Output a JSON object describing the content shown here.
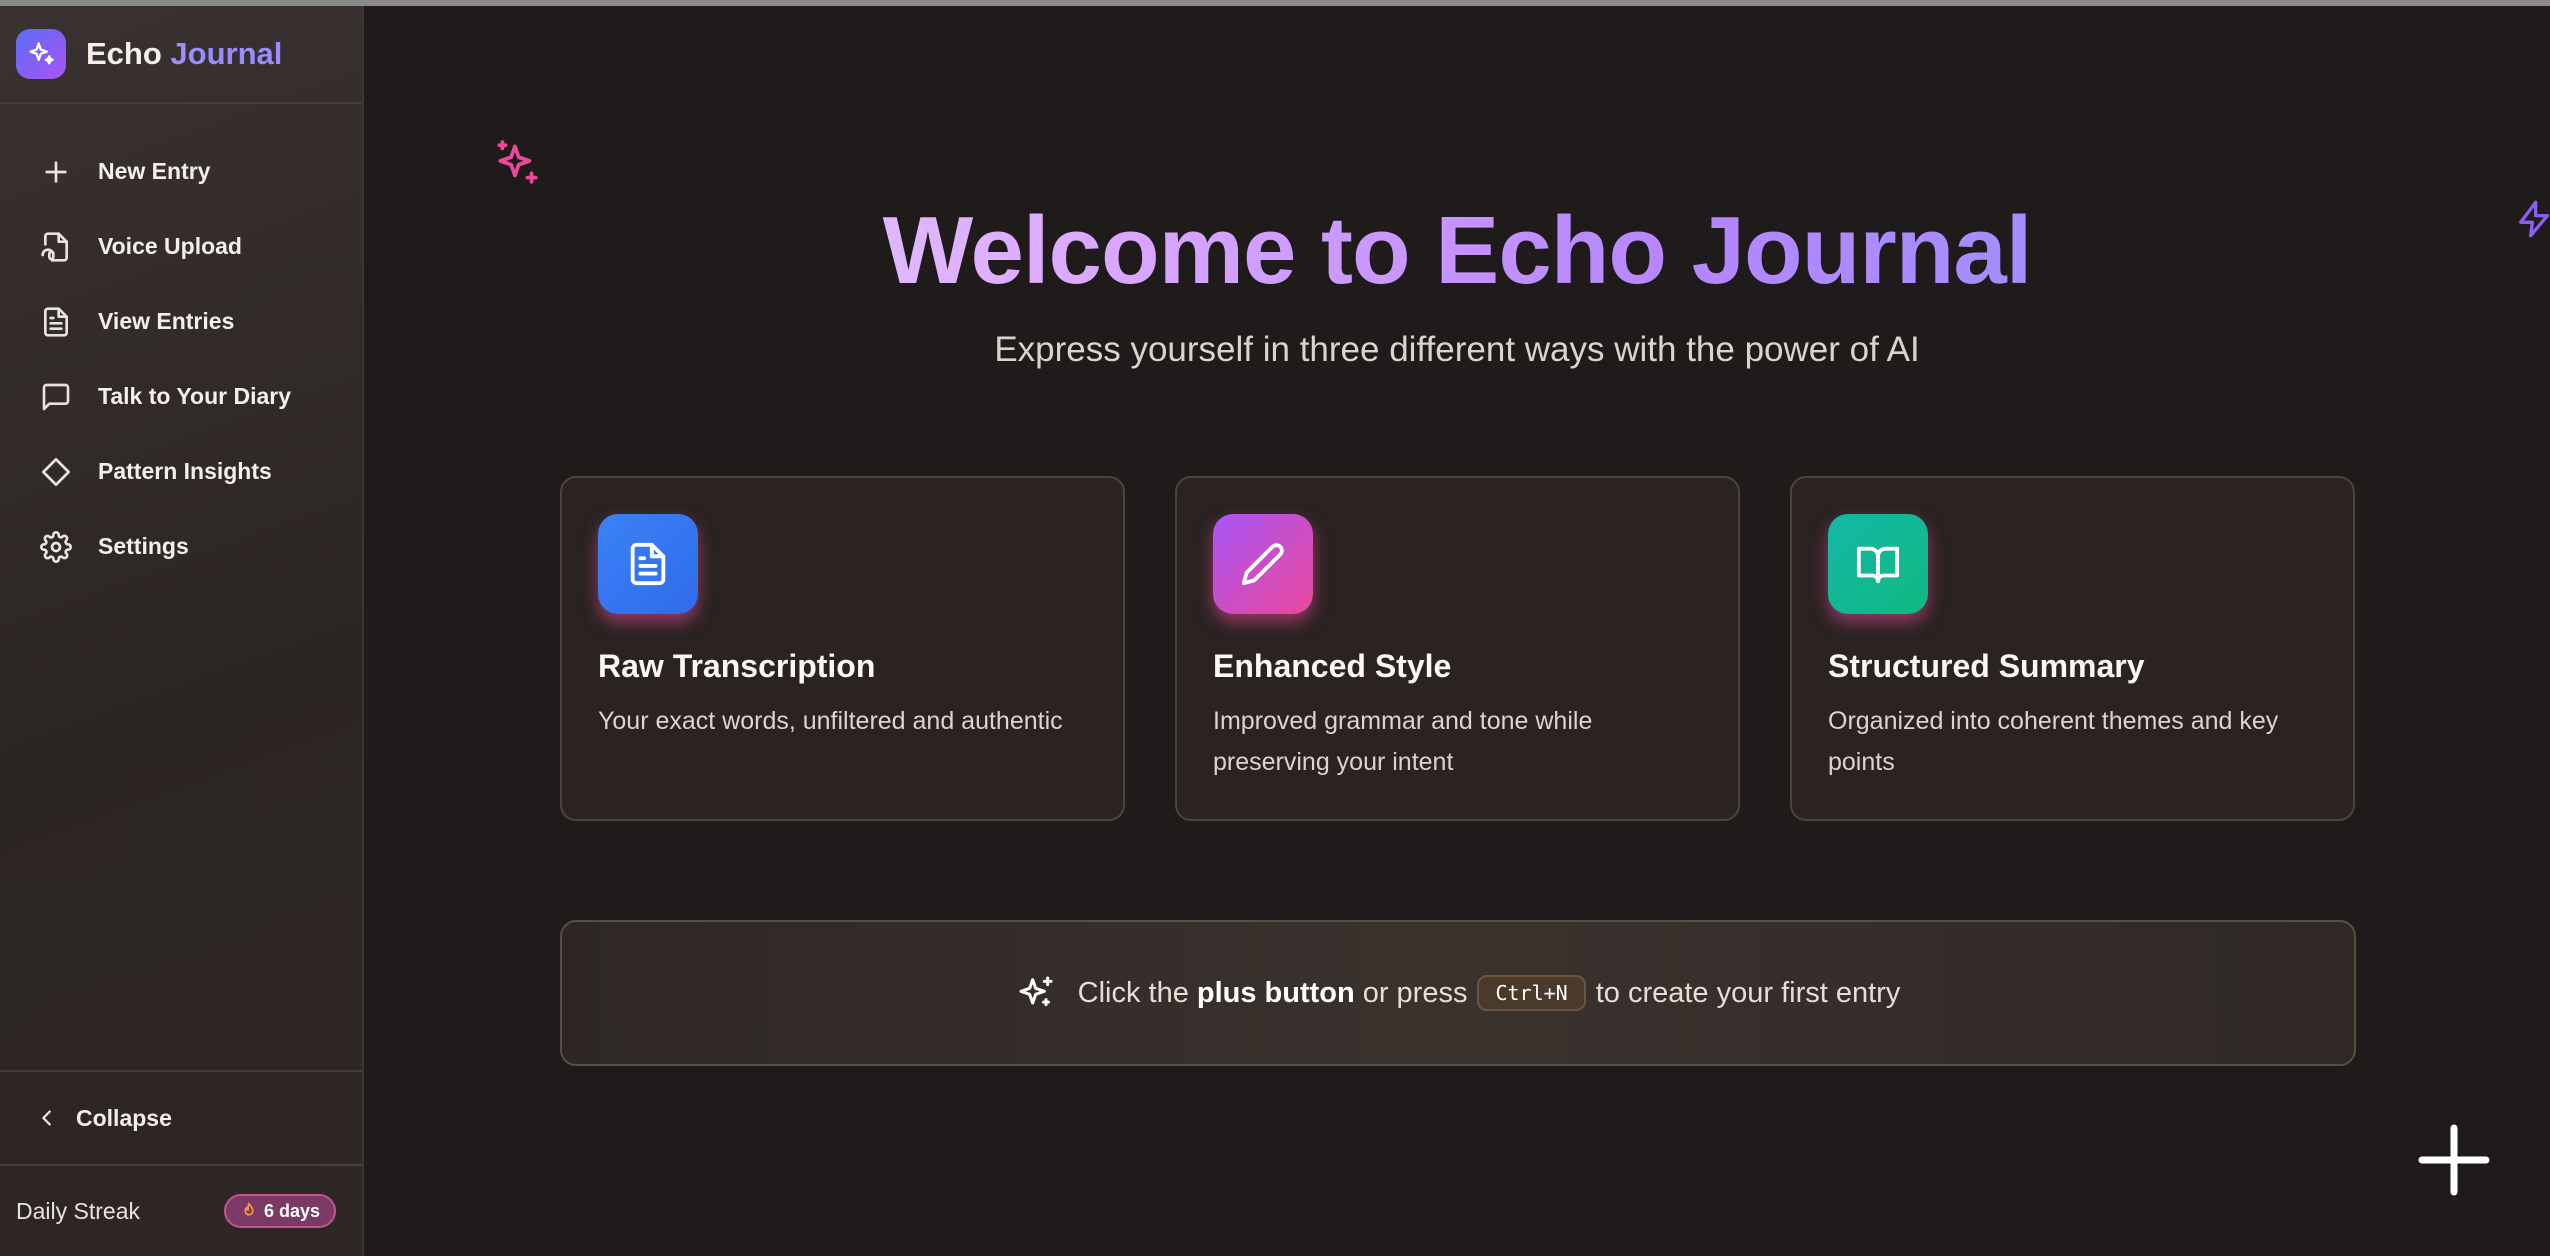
{
  "brand": {
    "name_part1": "Echo",
    "name_part2": "Journal",
    "logo_icon": "sparkles-icon"
  },
  "sidebar": {
    "items": [
      {
        "label": "New Entry",
        "icon": "plus-icon"
      },
      {
        "label": "Voice Upload",
        "icon": "file-audio-icon"
      },
      {
        "label": "View Entries",
        "icon": "file-text-icon"
      },
      {
        "label": "Talk to Your Diary",
        "icon": "message-square-icon"
      },
      {
        "label": "Pattern Insights",
        "icon": "diamond-icon"
      },
      {
        "label": "Settings",
        "icon": "gear-icon"
      }
    ],
    "collapse_label": "Collapse",
    "streak_label": "Daily Streak",
    "streak_value": "6 days"
  },
  "hero": {
    "title": "Welcome to Echo Journal",
    "subtitle": "Express yourself in three different ways with the power of AI"
  },
  "cards": [
    {
      "title": "Raw Transcription",
      "description": "Your exact words, unfiltered and authentic",
      "icon": "file-text-icon",
      "color": "#3b82f6"
    },
    {
      "title": "Enhanced Style",
      "description": "Improved grammar and tone while preserving your intent",
      "icon": "pencil-icon",
      "color": "#ec4899"
    },
    {
      "title": "Structured Summary",
      "description": "Organized into coherent themes and key points",
      "icon": "book-open-icon",
      "color": "#14b8a6"
    }
  ],
  "hint": {
    "prefix": "Click the",
    "bold": "plus button",
    "middle": "or press",
    "shortcut": "Ctrl+N",
    "suffix": "to create your first entry"
  },
  "colors": {
    "accent_pink": "#ec4899",
    "accent_purple": "#a855f7",
    "background": "#1f1b1b"
  }
}
